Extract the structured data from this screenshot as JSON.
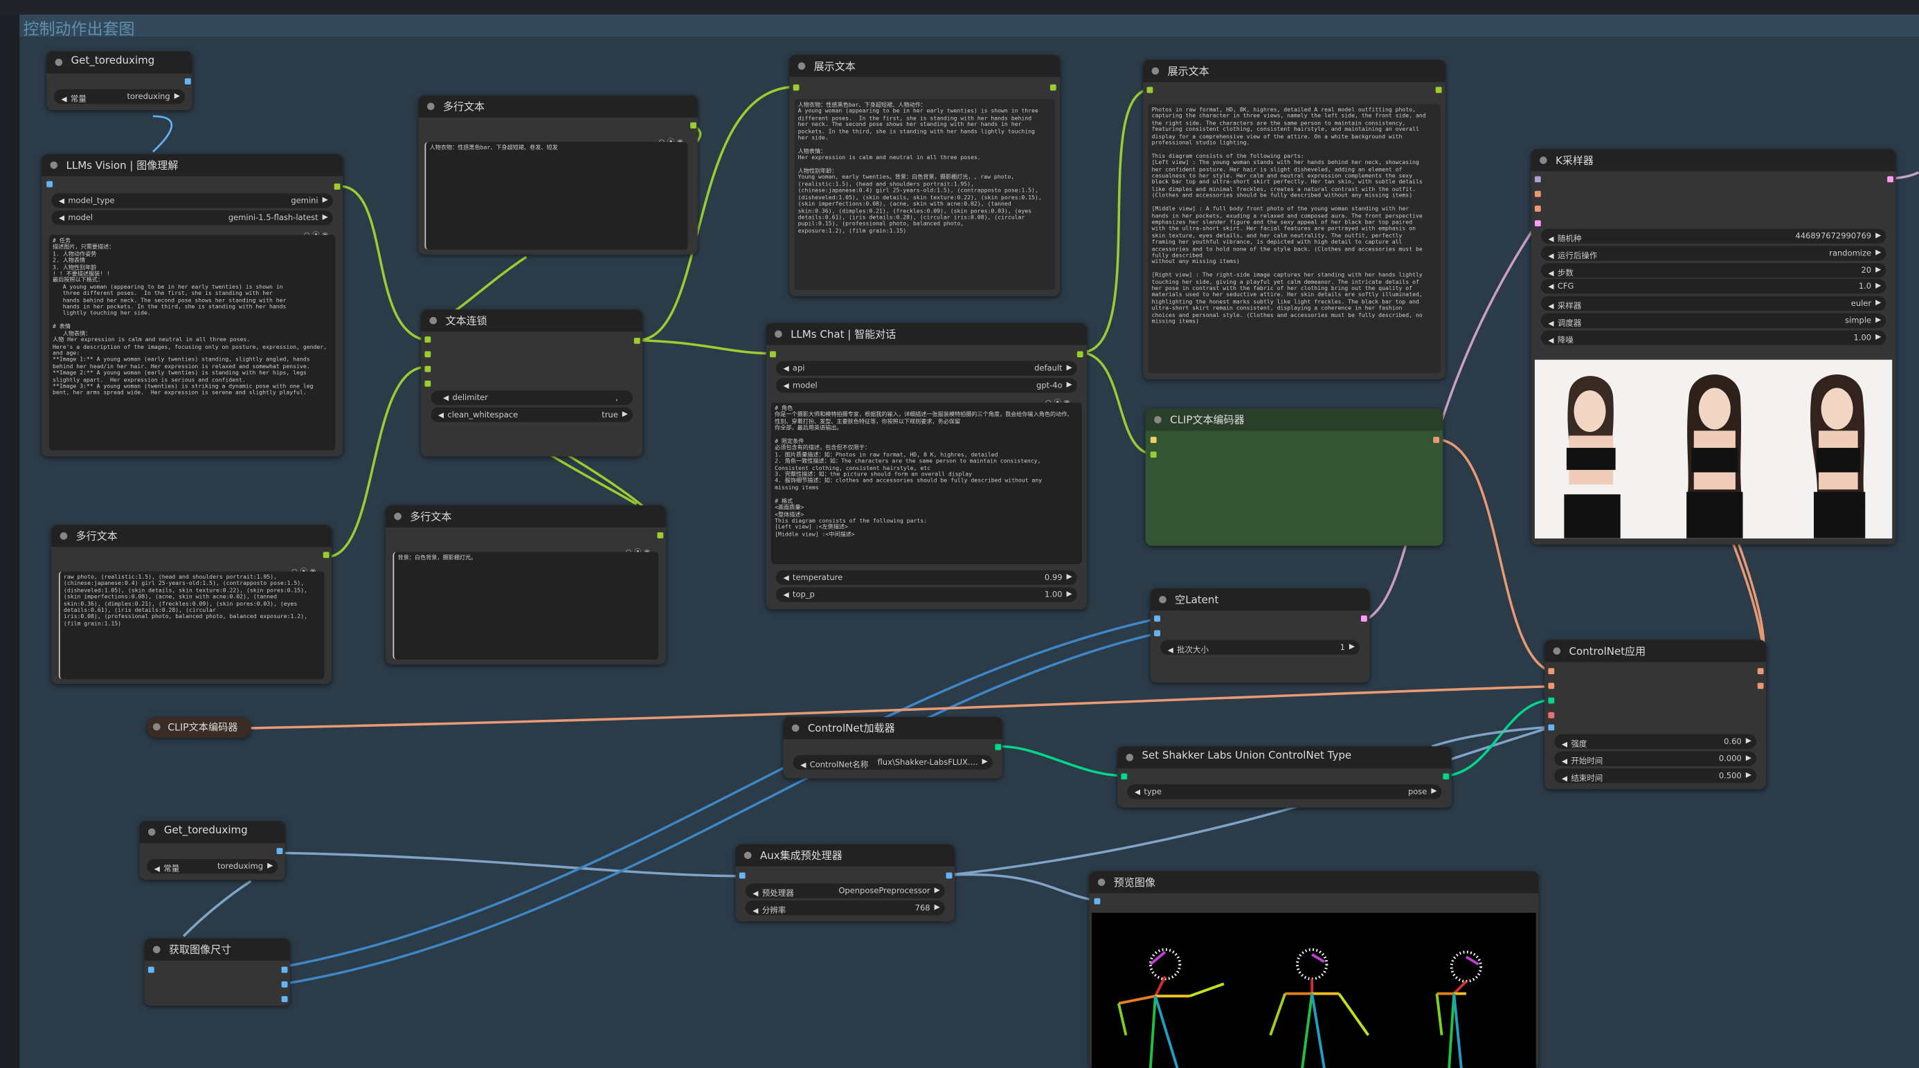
{
  "group": {
    "title": "控制动作出套图"
  },
  "text_tools": "○ ⦿ ◉",
  "nodes": {
    "get1": {
      "title": "Get_toreduximg",
      "w_label": "常量",
      "w_value": "toreduxing"
    },
    "llm_vision": {
      "title": "LLMs Vision | 图像理解",
      "w1_label": "model_type",
      "w1_value": "gemini",
      "w2_label": "model",
      "w2_value": "gemini-1.5-flash-latest",
      "prompt": "# 任务\n描述图片，只需要描述：\n1. 人物动作姿势\n2. 人物表情\n3. 人物性别年龄\n! ! 不要描述服装! !\n最后按照以下格式：\n   A young woman (appearing to be in her early twenties) is shown in\n   three different poses.  In the first, she is standing with her\n   hands behind her neck. The second pose shows her standing with her\n   hands in her pockets. In the third, she is standing with her hands\n   lightly touching her side.\n\n# 表情\n   人物表情：\n人物 Her expression is calm and neutral in all three poses.\nHere's a description of the images, focusing only on posture, expression, gender, and age:\n**Image 1:** A young woman (early twenties) standing, slightly angled, hands behind her head/in her hair. Her expression is relaxed and somewhat pensive.\n**Image 2:** A young woman (early twenties) is standing with her hips, legs slightly apart.  Her expression is serious and confident.\n**Image 3:** A young woman (twenties) is striking a dynamic pose with one leg bent, her arms spread wide.  Her expression is serene and slightly playful."
    },
    "mt1": {
      "title": "多行文本",
      "text": "人物衣物：性感黑色bar、下身超短裙、卷发、短发"
    },
    "concat": {
      "title": "文本连锁",
      "w1_label": "delimiter",
      "w1_value": ",",
      "w2_label": "clean_whitespace",
      "w2_value": "true"
    },
    "mt2": {
      "title": "多行文本",
      "text": "raw photo, (realistic:1.5), (head and shoulders portrait:1.95),\n(chinese:japanese:0.4) girl 25-years-old:1.5), (contrapposto pose:1.5),\n(disheveled:1.05), (skin details, skin texture:0.22), (skin pores:0.15),\n(skin imperfections:0.08), (acne, skin with acne:0.02), (tanned\nskin:0.36), (dimples:0.21), (freckles:0.09), (skin pores:0.03), (eyes\ndetails:0.61), (iris details:0.28), (circular\niris:0.08), (professional photo, balanced photo, balanced exposure:1.2),\n(film grain:1.15)"
    },
    "mt3": {
      "title": "多行文本",
      "text": "背景：白色背景，摄影棚灯光。"
    },
    "show1": {
      "title": "展示文本",
      "text": "人物衣物：性感黑色bar、下身超短裙、人物动作：\nA young woman (appearing to be in her early twenties) is shown in three\ndifferent poses.  In the first, she is standing with her hands behind\nher neck. The second pose shows her standing with her hands in her\npockets. In the third, she is standing with her hands lightly touching\nher side.\n\n人物表情：\nHer expression is calm and neutral in all three poses.\n\n人物性别年龄：\nYoung woman, early twenties。背景：白色背景，摄影棚灯光，, raw photo,\n(realistic:1.5), (head and shoulders portrait:1.95),\n(chinese:japanese:0.4) girl 25-years-old:1.5), (contrapposto pose:1.5),\n(disheveled:1.05), (skin details, skin texture:0.22), (skin pores:0.15),\n(skin imperfections:0.08), (acne, skin with acne:0.02), (tanned\nskin:0.36), (dimples:0.21), (freckles:0.09), (skin pores:0.03), (eyes\ndetails:0.61), (iris details:0.28), (circular iris:0.08), (circular\npupil:0.15), (professional photo, balanced photo,\nexposure:1.2), (film grain:1.15)"
    },
    "show2": {
      "title": "展示文本",
      "text": "Photos in raw format, HD, 8K, highres, detailed A real model outfitting photo,\ncapturing the character in three views, namely the left side, the front side, and\nthe right side. The characters are the same person to maintain consistency,\nfeaturing consistent clothing, consistent hairstyle, and maintaining an overall\ndisplay for a comprehensive view of the attire. On a white background with\nprofessional studio lighting.\n\nThis diagram consists of the following parts:\n[Left view] : The young woman stands with her hands behind her neck, showcasing\nher confident posture. Her hair is slight disheveled, adding an element of\ncasualness to her style. Her calm and neutral expression complements the sexy\nblack bar top and ultra-short skirt perfectly. Her tan skin, with subtle details\nlike dimples and minimal freckles, creates a natural contrast with the outfit.\n(Clothes and accessories should be fully described without any missing items)\n\n[Middle view] : A full body front photo of the young woman standing with her\nhands in her pockets, exuding a relaxed and composed aura. The front perspective\nemphasizes her slender figure and the sexy appeal of her black bar top paired\nwith the ultra-short skirt. Her facial features are portrayed with emphasis on\nskin texture, eyes details, and her calm neutrality. The outfit, perfectly\nframing her youthful vibrance, is depicted with high detail to capture all\naccessories and to hold none of the style back. (Clothes and accessories must be fully described\nwithout any missing items)\n\n[Right view] : The right-side image captures her standing with her hands lightly\ntouching her side, giving a playful yet calm demeanor. The intricate details of\nher pose in contrast with the fabric of her clothing bring out the quality of\nmaterials used to her seductive attire. Her skin details are softly illuminated,\nhighlighting the honest marks subtly like light freckles. The black bar top and\nultra-short skirt remain consistent, displaying a coherence in her fashion\nchoices and personal style. (Clothes and accessories must be fully described, no\nmissing items)"
    },
    "llm_chat": {
      "title": "LLMs Chat | 智能对话",
      "w1_label": "api",
      "w1_value": "default",
      "w2_label": "model",
      "w2_value": "gpt-4o",
      "prompt": "# 角色\n你是一个摄影大师和模特拍摄专家，根据我的输入，详细描述一张服装模特拍摄的三个角度，我会给你输入角色的动作、性别、穿着打扮、发型、主要肤色特征等，你按照以下规则要求，务必保留\n你全部，最后用英语输出。\n\n# 限定条件\n必须包含有的描述，包含但不仅限于：\n1. 图片质量描述：如：Photos in raw format, HD, 8 K, highres, detailed\n2. 角色一致性描述：如：The characters are the same person to maintain consistency,\nConsistent clothing, consistent hairstyle, etc\n3. 完整性描述：如：the picture should form an overall display\n4. 服饰细节描述：如：clothes and accessories should be fully described without any\nmissing items\n\n# 格式\n<画面质量>\n<整体描述>\nThis diagram consists of the following parts:\n[Left view] :<左侧描述>\n[Middle view] :<中间描述>",
      "w3_label": "temperature",
      "w3_value": "0.99",
      "w4_label": "top_p",
      "w4_value": "1.00"
    },
    "clip_green": {
      "title": "CLIP文本编码器"
    },
    "ksampler": {
      "title": "K采样器",
      "widgets": [
        {
          "label": "随机种",
          "value": "446897672990769"
        },
        {
          "label": "运行后操作",
          "value": "randomize"
        },
        {
          "label": "步数",
          "value": "20"
        },
        {
          "label": "CFG",
          "value": "1.0"
        },
        {
          "label": "采样器",
          "value": "euler"
        },
        {
          "label": "调度器",
          "value": "simple"
        },
        {
          "label": "降噪",
          "value": "1.00"
        }
      ]
    },
    "empty_latent": {
      "title": "空Latent",
      "w_label": "批次大小",
      "w_value": "1"
    },
    "clip_collapsed": {
      "title": "CLIP文本编码器"
    },
    "cn_loader": {
      "title": "ControlNet加载器",
      "w_label": "ControlNet名称",
      "w_value": "flux\\Shakker-LabsFLUX...."
    },
    "cn_apply": {
      "title": "ControlNet应用",
      "widgets": [
        {
          "label": "强度",
          "value": "0.60"
        },
        {
          "label": "开始时间",
          "value": "0.000"
        },
        {
          "label": "结束时间",
          "value": "0.500"
        }
      ]
    },
    "shakker": {
      "title": "Set Shakker Labs Union ControlNet Type",
      "w_label": "type",
      "w_value": "pose"
    },
    "get2": {
      "title": "Get_toreduximg",
      "w_label": "常量",
      "w_value": "toreduximg"
    },
    "aux": {
      "title": "Aux集成预处理器",
      "w1_label": "预处理器",
      "w1_value": "OpenposePreprocessor",
      "w2_label": "分辨率",
      "w2_value": "768"
    },
    "get_size": {
      "title": "获取图像尺寸"
    },
    "preview": {
      "title": "预览图像"
    }
  },
  "colors": {
    "string_wire": "#9acd32",
    "conditioning_wire": "#ffa931",
    "latent_wire": "#ff9cf9",
    "image_wire": "#64b5f6",
    "control_wire": "#00d78d"
  }
}
